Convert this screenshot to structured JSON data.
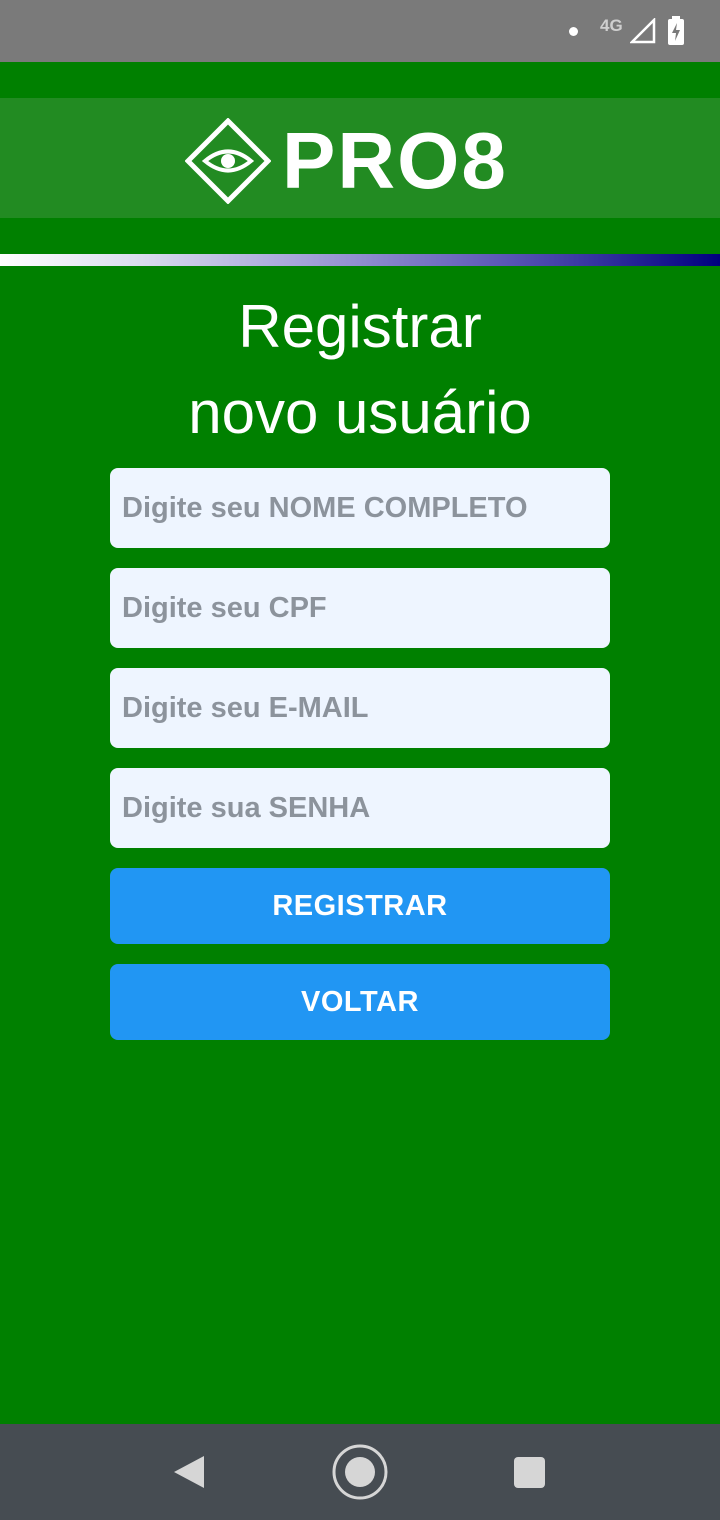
{
  "status_bar": {
    "network": "4G",
    "icons": [
      "notification-dot-icon",
      "signal-icon",
      "battery-charging-icon"
    ]
  },
  "header": {
    "logo_text": "PRO8",
    "logo_icon": "eye-diamond-icon"
  },
  "page": {
    "title_line1": "Registrar",
    "title_line2": "novo usuário"
  },
  "form": {
    "name_placeholder": "Digite seu NOME COMPLETO",
    "cpf_placeholder": "Digite seu CPF",
    "email_placeholder": "Digite seu E-MAIL",
    "password_placeholder": "Digite sua SENHA",
    "register_label": "REGISTRAR",
    "back_label": "VOLTAR"
  },
  "nav_bar": {
    "icons": [
      "back-triangle-icon",
      "home-circle-icon",
      "recent-apps-square-icon"
    ]
  },
  "colors": {
    "background": "#008000",
    "logo_band": "#228b22",
    "input_background": "#eef5ff",
    "button": "#2196f3",
    "status_bar": "#7a7a7a",
    "nav_bar": "#464c52"
  }
}
